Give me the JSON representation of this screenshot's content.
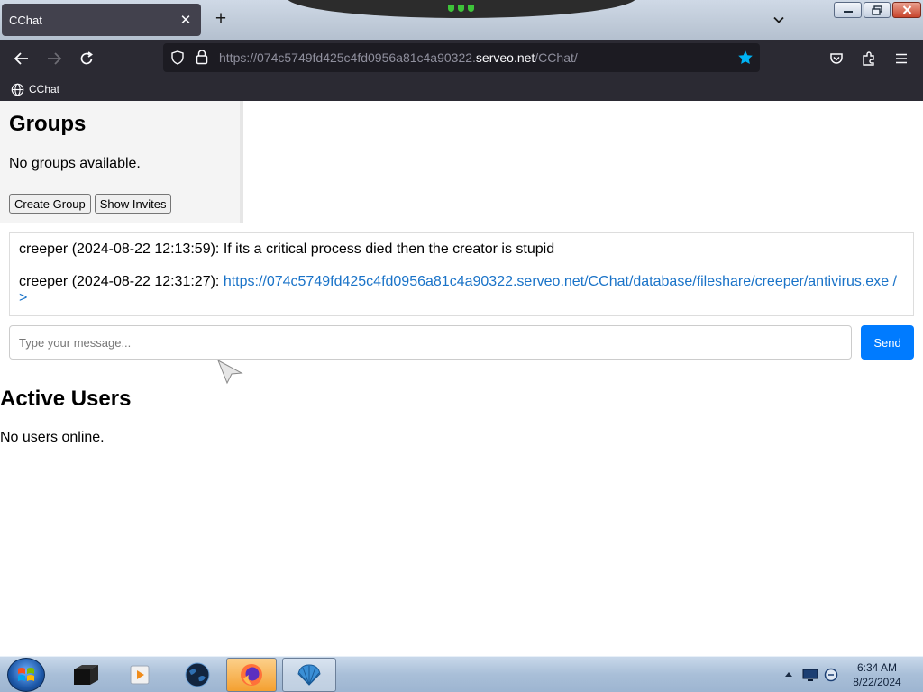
{
  "browser": {
    "tab": {
      "title": "CChat",
      "close_glyph": "✕"
    },
    "new_tab_glyph": "+",
    "url": {
      "prefix": "https://074c5749fd425c4fd0956a81c4a90322.",
      "domain": "serveo.net",
      "path": "/CChat/"
    },
    "bookmark": {
      "label": "CChat"
    }
  },
  "page": {
    "groups": {
      "title": "Groups",
      "empty_text": "No groups available.",
      "create_label": "Create Group",
      "invites_label": "Show Invites"
    },
    "messages": [
      {
        "text": "creeper (2024-08-22 12:13:59): If its a critical process died then the creator is stupid"
      },
      {
        "prefix": "creeper (2024-08-22 12:31:27): ",
        "link": "https://074c5749fd425c4fd0956a81c4a90322.serveo.net/CChat/database/fileshare/creeper/antivirus.exe />"
      }
    ],
    "composer": {
      "placeholder": "Type your message...",
      "send_label": "Send"
    },
    "users": {
      "title": "Active Users",
      "empty_text": "No users online."
    }
  },
  "taskbar": {
    "clock": {
      "time": "6:34 AM",
      "date": "8/22/2024"
    },
    "pinned": [
      "terminal-icon",
      "media-player-icon",
      "globe-icon",
      "firefox-icon",
      "shell-icon"
    ]
  },
  "colors": {
    "accent": "#007bff",
    "link": "#1a73c8",
    "chrome_dark": "#2b2a33",
    "bookmark_star": "#00b3f4"
  }
}
